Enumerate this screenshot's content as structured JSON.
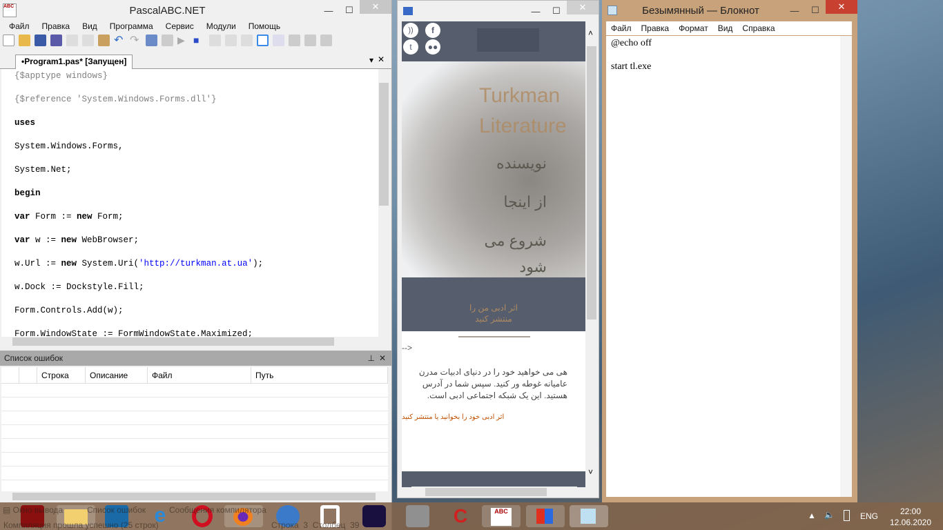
{
  "pascal": {
    "title": "PascalABC.NET",
    "menu": [
      "Файл",
      "Правка",
      "Вид",
      "Программа",
      "Сервис",
      "Модули",
      "Помощь"
    ],
    "tab": "•Program1.pas* [Запущен]",
    "code": [
      [
        [
          "cm",
          "{$apptype windows}"
        ]
      ],
      [
        [
          "cm",
          "{$reference 'System.Windows.Forms.dll'}"
        ]
      ],
      [
        [
          "kw",
          "uses"
        ]
      ],
      [
        [
          "tx",
          "System.Windows.Forms,"
        ]
      ],
      [
        [
          "tx",
          "System.Net;"
        ]
      ],
      [
        [
          "kw",
          "begin"
        ]
      ],
      [
        [
          "kw",
          "var"
        ],
        [
          "tx",
          " Form := "
        ],
        [
          "kw",
          "new"
        ],
        [
          "tx",
          " Form;"
        ]
      ],
      [
        [
          "kw",
          "var"
        ],
        [
          "tx",
          " w := "
        ],
        [
          "kw",
          "new"
        ],
        [
          "tx",
          " WebBrowser;"
        ]
      ],
      [
        [
          "tx",
          "w.Url := "
        ],
        [
          "kw",
          "new"
        ],
        [
          "tx",
          " System.Uri("
        ],
        [
          "st",
          "'http://turkman.at.ua'"
        ],
        [
          "tx",
          ");"
        ]
      ],
      [
        [
          "tx",
          "w.Dock := Dockstyle.Fill;"
        ]
      ],
      [
        [
          "tx",
          "Form.Controls.Add(w);"
        ]
      ],
      [
        [
          "tx",
          "Form.WindowState := FormWindowState.Maximized;"
        ]
      ]
    ],
    "errors": {
      "title": "Список ошибок",
      "columns": [
        "",
        "",
        "Строка",
        "Описание",
        "Файл",
        "Путь"
      ]
    },
    "status": {
      "tabs": [
        "Окно вывода",
        "Список ошибок",
        "Сообщения компилятора"
      ],
      "message": "Компиляция прошла успешно (25 строк)",
      "position": "Строка  3  Столбец  39"
    }
  },
  "browser": {
    "header_title": "Turkman Literature",
    "hero_lines": [
      "نویسنده",
      "از اینجا",
      "شروع می",
      "شود"
    ],
    "band_text": [
      "اثر ادبی من را",
      "منتشر کنید"
    ],
    "arrow": "-->",
    "paragraph": [
      "هی  می خواهید خود را در دنیای ادبیات مدرن",
      "عامیانه غوطه ور کنید.  سپس شما در آدرس",
      "هستید.  این یک شبکه اجتماعی ادبی است."
    ],
    "link": "اثر ادبی خود را بخوانید یا منتشر کنید",
    "colors": {
      "dark": "#565e6e",
      "accent": "#b08a60",
      "link": "#c05000"
    }
  },
  "notepad": {
    "title": "Безымянный — Блокнот",
    "menu": [
      "Файл",
      "Правка",
      "Формат",
      "Вид",
      "Справка"
    ],
    "lines": [
      "@echo off",
      "",
      "start tl.exe"
    ]
  },
  "tray": {
    "lang": "ENG",
    "time": "22:00",
    "date": "12.06.2020"
  }
}
